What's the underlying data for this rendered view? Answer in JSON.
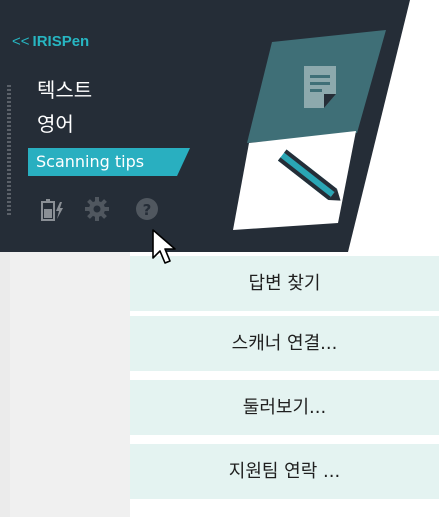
{
  "panel": {
    "brand": "IRISPen",
    "collapse_glyph": "<<",
    "text_mode": "텍스트",
    "language": "영어",
    "tips_label": "Scanning tips",
    "icons": [
      "battery-charging-icon",
      "gear-icon",
      "help-icon"
    ],
    "colors": {
      "panel_bg": "#252d37",
      "accent": "#29afc0"
    }
  },
  "menu": {
    "items": [
      {
        "label": "답변 찾기"
      },
      {
        "label": "스캐너 연결..."
      },
      {
        "label": "둘러보기..."
      },
      {
        "label": "지원팀 연락 ..."
      }
    ]
  }
}
